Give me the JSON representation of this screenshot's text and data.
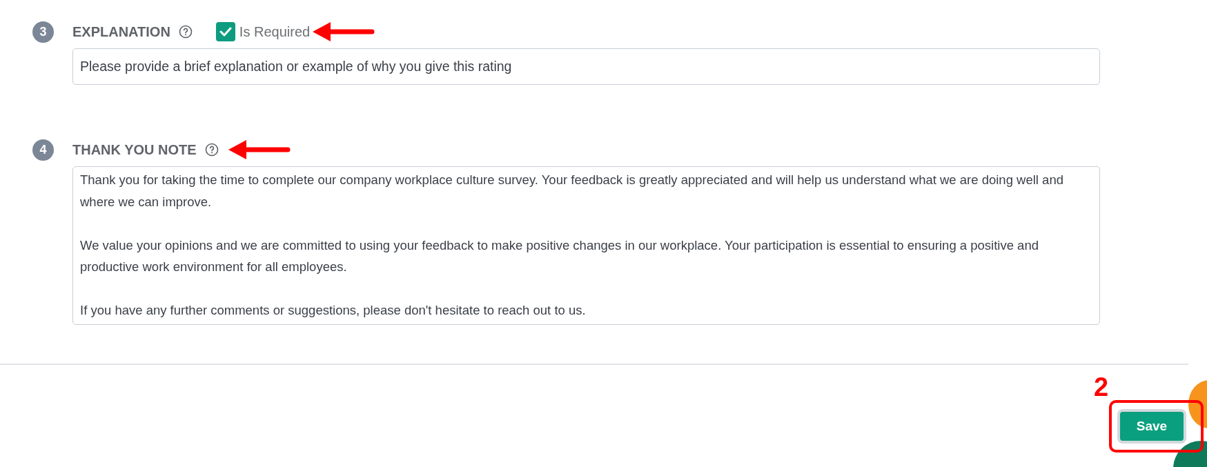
{
  "questions": [
    {
      "number": "3",
      "label": "EXPLANATION",
      "required": {
        "label": "Is Required",
        "checked": true
      },
      "arrow": true,
      "field": {
        "kind": "input",
        "value": "Please provide a brief explanation or example of why you give this rating"
      }
    },
    {
      "number": "4",
      "label": "THANK YOU NOTE",
      "arrow": true,
      "field": {
        "kind": "textarea",
        "value": "Thank you for taking the time to complete our company workplace culture survey. Your feedback is greatly appreciated and will help us understand what we are doing well and where we can improve.\n\nWe value your opinions and we are committed to using your feedback to make positive changes in our workplace. Your participation is essential to ensuring a positive and productive work environment for all employees.\n\nIf you have any further comments or suggestions, please don't hesitate to reach out to us."
      }
    }
  ],
  "footer": {
    "step_label": "2",
    "highlighted": true,
    "save_button": "Save"
  }
}
